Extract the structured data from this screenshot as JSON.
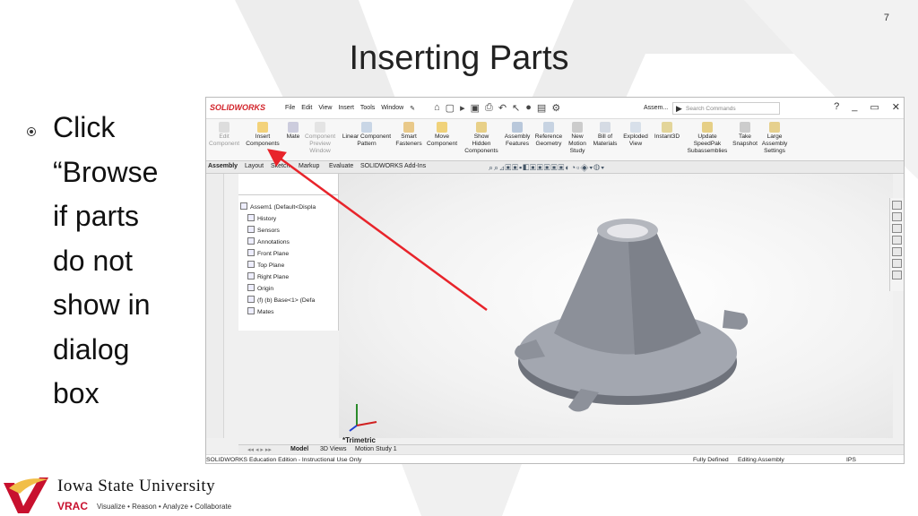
{
  "slide": {
    "number": "7",
    "title": "Inserting Parts",
    "bullet_lines": [
      "Click",
      "“Browse",
      "if parts",
      "do not",
      "show in",
      "dialog",
      "box"
    ]
  },
  "software": {
    "logo": "SOLIDWORKS",
    "menu": [
      "File",
      "Edit",
      "View",
      "Insert",
      "Tools",
      "Window"
    ],
    "doc_title": "Assem...",
    "search_placeholder": "Search Commands",
    "ribbon": [
      {
        "label": "Edit\nComponent",
        "dim": true
      },
      {
        "label": "Insert\nComponents",
        "dim": false
      },
      {
        "label": "Mate",
        "dim": false
      },
      {
        "label": "Component\nPreview\nWindow",
        "dim": true
      },
      {
        "label": "Linear Component\nPattern",
        "dim": false
      },
      {
        "label": "Smart\nFasteners",
        "dim": false
      },
      {
        "label": "Move\nComponent",
        "dim": false
      },
      {
        "label": "Show\nHidden\nComponents",
        "dim": false
      },
      {
        "label": "Assembly\nFeatures",
        "dim": false
      },
      {
        "label": "Reference\nGeometry",
        "dim": false
      },
      {
        "label": "New\nMotion\nStudy",
        "dim": false
      },
      {
        "label": "Bill of\nMaterials",
        "dim": false
      },
      {
        "label": "Exploded\nView",
        "dim": false
      },
      {
        "label": "Instant3D",
        "dim": false
      },
      {
        "label": "Update\nSpeedPak\nSubassemblies",
        "dim": false
      },
      {
        "label": "Take\nSnapshot",
        "dim": false
      },
      {
        "label": "Large\nAssembly\nSettings",
        "dim": false
      }
    ],
    "tabs": [
      "Assembly",
      "Layout",
      "Sketch",
      "Markup",
      "Evaluate",
      "SOLIDWORKS Add-Ins"
    ],
    "active_tab": "Assembly",
    "tree": [
      {
        "label": "Assem1  (Default<Displa",
        "indent": 0
      },
      {
        "label": "History",
        "indent": 1
      },
      {
        "label": "Sensors",
        "indent": 1
      },
      {
        "label": "Annotations",
        "indent": 1
      },
      {
        "label": "Front Plane",
        "indent": 1
      },
      {
        "label": "Top Plane",
        "indent": 1
      },
      {
        "label": "Right Plane",
        "indent": 1
      },
      {
        "label": "Origin",
        "indent": 1
      },
      {
        "label": "(f) (b) Base<1> (Defa",
        "indent": 1
      },
      {
        "label": "Mates",
        "indent": 1
      }
    ],
    "view_label": "*Trimetric",
    "bottom_tabs": [
      "Model",
      "3D Views",
      "Motion Study 1"
    ],
    "active_bottom_tab": "Model",
    "status_left": "SOLIDWORKS Education Edition - Instructional Use Only",
    "status_defined": "Fully Defined",
    "status_mode": "Editing Assembly",
    "status_units": "IPS"
  },
  "footer": {
    "university": "Iowa State University",
    "lab": "VRAC",
    "tagline": "Visualize • Reason • Analyze • Collaborate"
  },
  "colors": {
    "annotation_arrow": "#e8242b",
    "brand_red": "#c8102e",
    "brand_gold": "#f1be48",
    "part_gray": "#8e929c"
  }
}
